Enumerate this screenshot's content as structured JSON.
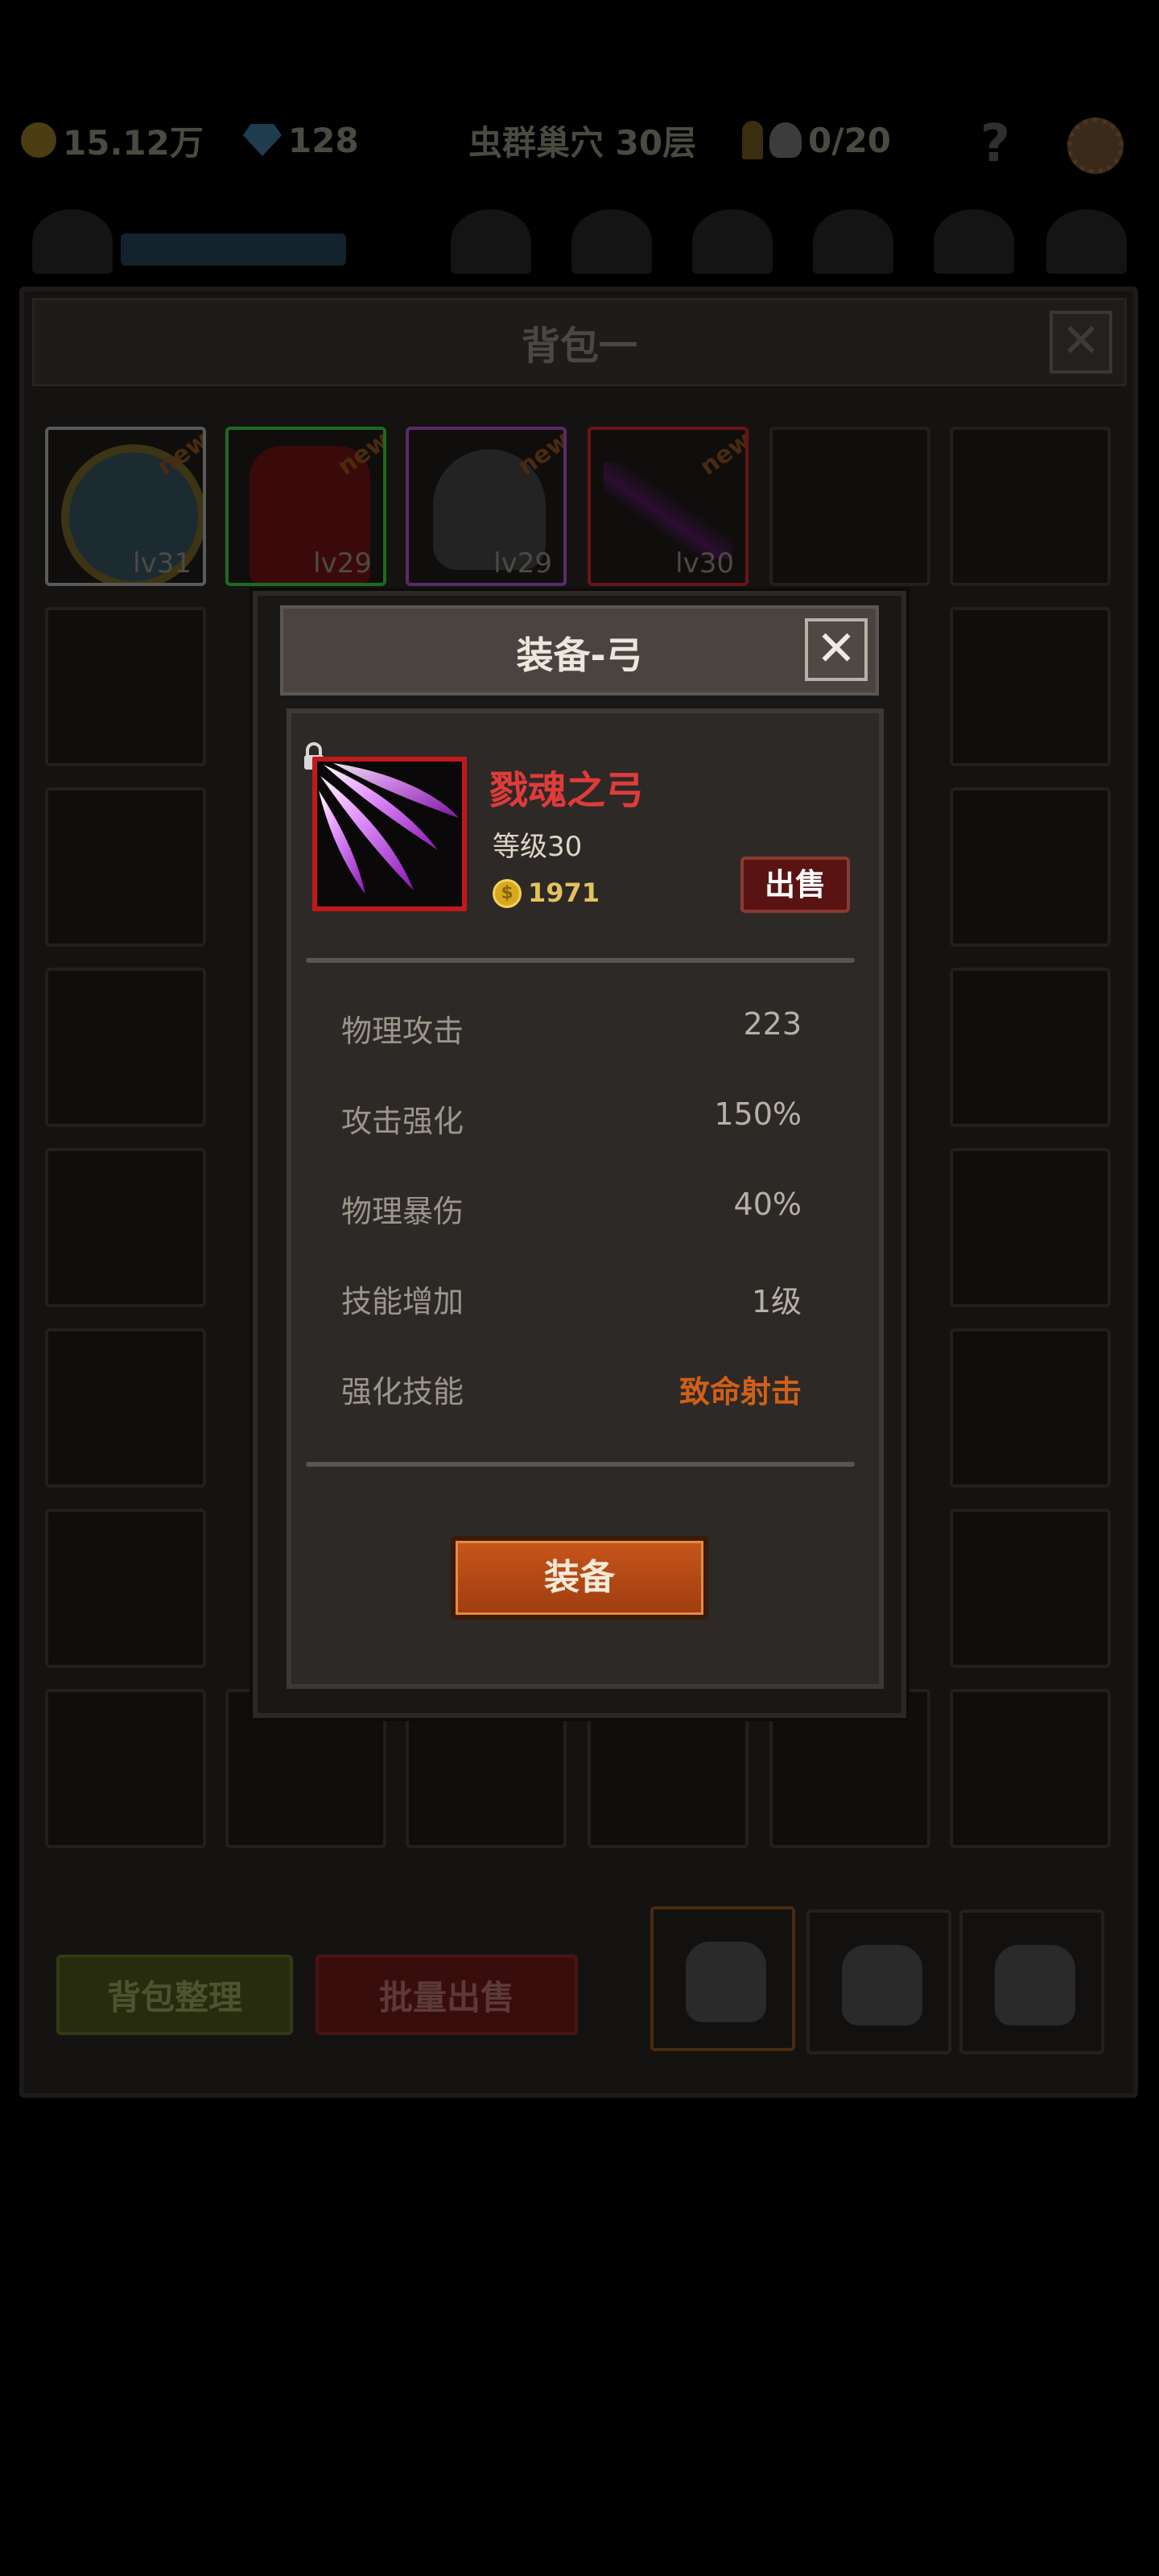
{
  "topbar": {
    "gold": "15.12万",
    "gems": "128",
    "stage": "虫群巢穴 30层",
    "keys": "0/20",
    "help": "?"
  },
  "backpack": {
    "title": "背包一",
    "close": "✕",
    "items": [
      {
        "kind": "shield",
        "level": "lv31",
        "badge": "new",
        "border": "#5a5a5a"
      },
      {
        "kind": "armor",
        "level": "lv29",
        "badge": "new",
        "border": "#1f6a1f"
      },
      {
        "kind": "helmet",
        "level": "lv29",
        "badge": "new",
        "border": "#5a2a6a"
      },
      {
        "kind": "bow",
        "level": "lv30",
        "badge": "new",
        "border": "#6a1414"
      }
    ],
    "sort_button": "背包整理",
    "bulk_sell_button": "批量出售"
  },
  "modal": {
    "title": "装备-弓",
    "close": "✕",
    "item": {
      "name": "戮魂之弓",
      "level": "等级30",
      "price": "1971",
      "sell_button": "出售"
    },
    "stats": [
      {
        "label": "物理攻击",
        "value": "223"
      },
      {
        "label": "攻击强化",
        "value": "150%"
      },
      {
        "label": "物理暴伤",
        "value": "40%"
      },
      {
        "label": "技能增加",
        "value": "1级"
      },
      {
        "label": "强化技能",
        "value": "致命射击",
        "highlight": true
      }
    ],
    "equip_button": "装备"
  },
  "colors": {
    "item_name": "#e03b3b",
    "gold": "#e3c25b",
    "skill_highlight": "#d06018",
    "equip_button": "#c7561b",
    "sell_button": "#5a1313"
  }
}
